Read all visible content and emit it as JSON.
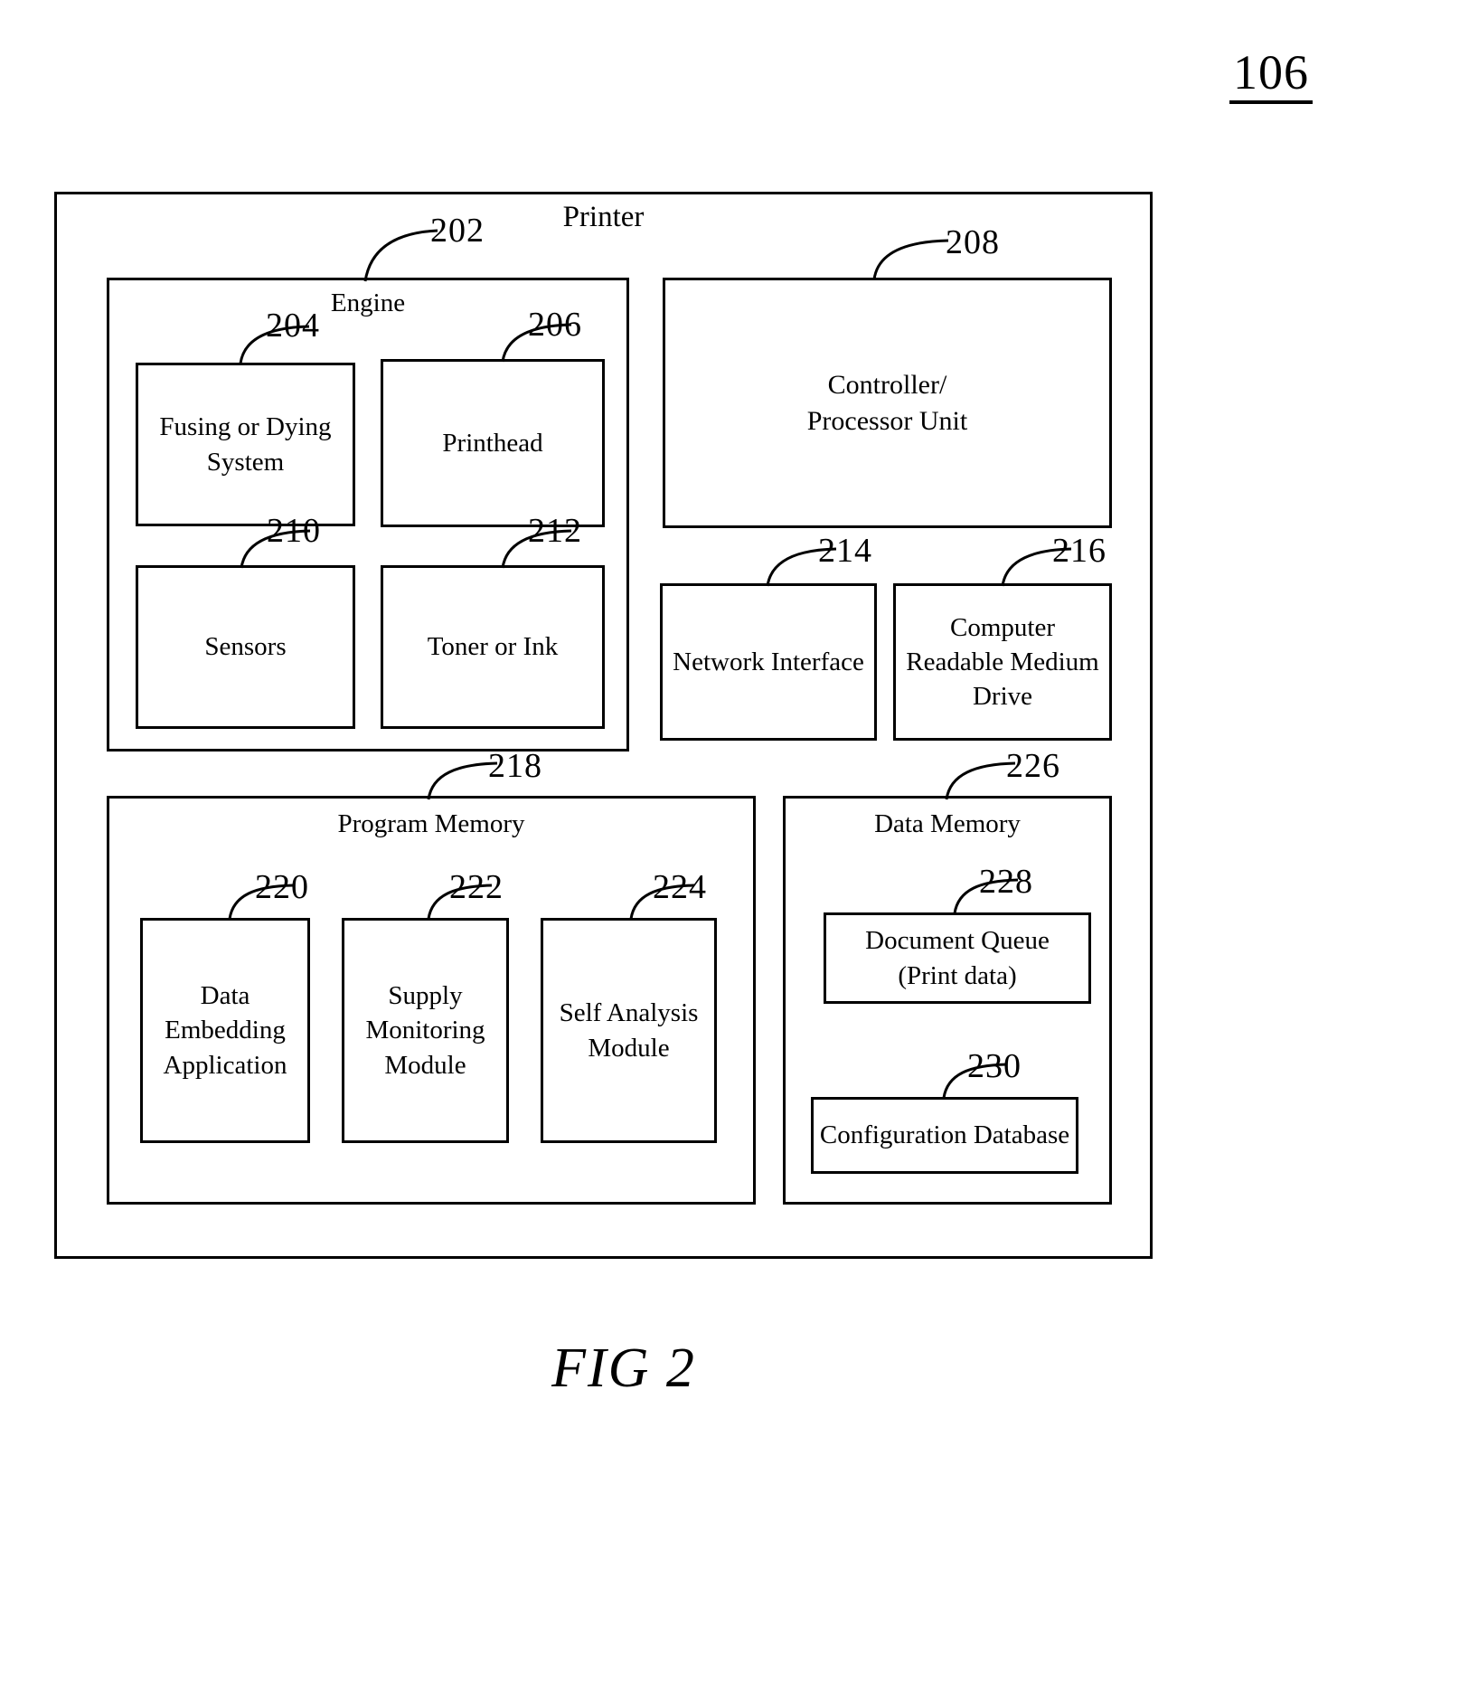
{
  "figure": {
    "top_reference": "106",
    "caption": "FIG 2"
  },
  "printer": {
    "title": "Printer",
    "engine": {
      "label": "Engine",
      "ref": "202",
      "components": [
        {
          "label": "Fusing or Dying System",
          "ref": "204"
        },
        {
          "label": "Printhead",
          "ref": "206"
        },
        {
          "label": "Sensors",
          "ref": "210"
        },
        {
          "label": "Toner or Ink",
          "ref": "212"
        }
      ]
    },
    "controller": {
      "label": "Controller/ Processor Unit",
      "ref": "208"
    },
    "network_interface": {
      "label": "Network Interface",
      "ref": "214"
    },
    "crm_drive": {
      "label": "Computer Readable Medium Drive",
      "ref": "216"
    },
    "program_memory": {
      "label": "Program Memory",
      "ref": "218",
      "modules": [
        {
          "label": "Data Embedding Application",
          "ref": "220"
        },
        {
          "label": "Supply Monitoring Module",
          "ref": "222"
        },
        {
          "label": "Self Analysis Module",
          "ref": "224"
        }
      ]
    },
    "data_memory": {
      "label": "Data Memory",
      "ref": "226",
      "stores": [
        {
          "label": "Document Queue (Print data)",
          "ref": "228"
        },
        {
          "label": "Configuration Database",
          "ref": "230"
        }
      ]
    }
  }
}
